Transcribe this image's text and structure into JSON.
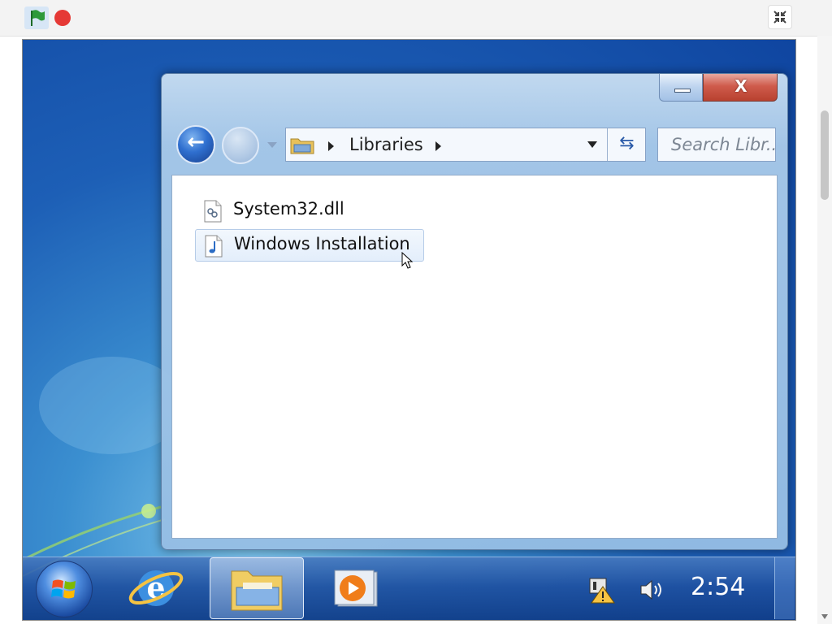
{
  "explorer": {
    "breadcrumb": [
      "Libraries"
    ],
    "search_placeholder": "Search Libr...",
    "caption": {
      "minimize_glyph": "—",
      "close_glyph": "X"
    },
    "nav": {
      "back_glyph": "←",
      "refresh_glyph": "⇆"
    },
    "items": [
      {
        "label": "System32.dll",
        "icon": "dll-file-icon",
        "selected": false
      },
      {
        "label": "Windows Installation",
        "icon": "music-file-icon",
        "selected": true
      }
    ]
  },
  "taskbar": {
    "clock": "2:54",
    "pinned": [
      "start-orb",
      "internet-explorer",
      "windows-explorer",
      "media-player"
    ],
    "active": "windows-explorer",
    "tray": [
      "network-warning-icon",
      "volume-icon"
    ]
  },
  "colors": {
    "desktop": "#1d5fb6",
    "window_frame": "#aecbea",
    "close_button": "#c84b3b",
    "selection": "#e3eefb",
    "stop_button": "#e53935",
    "flag": "#2e9a3a"
  }
}
